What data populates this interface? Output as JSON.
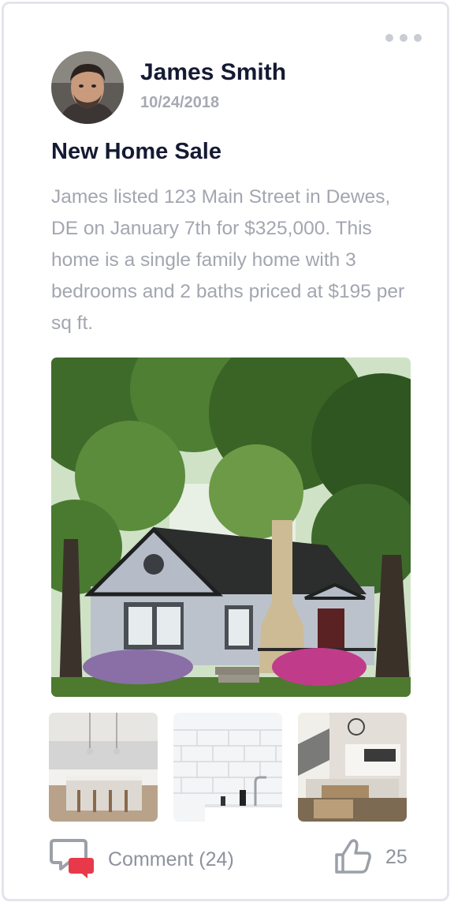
{
  "post": {
    "author": "James Smith",
    "date": "10/24/2018",
    "title": "New Home Sale",
    "description": "James listed 123 Main Street in Dewes, DE on January 7th for $325,000.  This home is a single family home with 3 bedrooms and 2 baths priced at $195 per sq ft."
  },
  "photos": {
    "main": "house-exterior",
    "thumbnails": [
      "kitchen",
      "bathroom",
      "living-room"
    ]
  },
  "actions": {
    "comment_label": "Comment (24)",
    "like_count": "25",
    "comment_icon": "comment-bubbles-icon",
    "like_icon": "thumbs-up-icon",
    "more_icon": "more-dots-icon"
  },
  "colors": {
    "heading": "#151a33",
    "muted": "#a3a6b0",
    "accent": "#e8394a",
    "border": "#e3e5ea"
  }
}
